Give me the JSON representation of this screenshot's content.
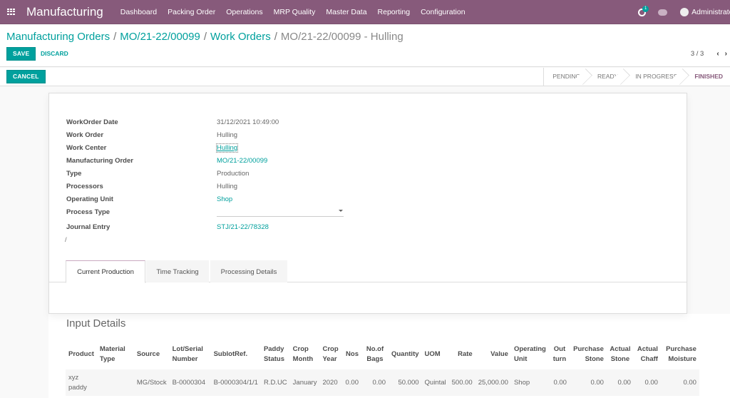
{
  "navbar": {
    "app_name": "Manufacturing",
    "menu": [
      "Dashboard",
      "Packing Order",
      "Operations",
      "MRP Quality",
      "Master Data",
      "Reporting",
      "Configuration"
    ],
    "activity_count": "1",
    "user": "Administrator"
  },
  "breadcrumb": {
    "items": [
      "Manufacturing Orders",
      "MO/21-22/00099",
      "Work Orders"
    ],
    "separator": "/",
    "current": "MO/21-22/00099 - Hulling"
  },
  "buttons": {
    "save": "SAVE",
    "discard": "DISCARD",
    "cancel": "CANCEL"
  },
  "pager": {
    "value": "3 / 3",
    "prev": "‹",
    "next": "›"
  },
  "stages": [
    {
      "label": "PENDING",
      "active": false
    },
    {
      "label": "READY",
      "active": false
    },
    {
      "label": "IN PROGRESS",
      "active": false
    },
    {
      "label": "FINISHED",
      "active": true
    }
  ],
  "form": {
    "fields": [
      {
        "label": "WorkOrder Date",
        "value": "31/12/2021 10:49:00"
      },
      {
        "label": "Work Order",
        "value": "Hulling"
      },
      {
        "label": "Work Center",
        "value": "Hulling"
      },
      {
        "label": "Manufacturing Order",
        "value": "MO/21-22/00099"
      },
      {
        "label": "Type",
        "value": "Production"
      },
      {
        "label": "Processors",
        "value": "Hulling"
      },
      {
        "label": "Operating Unit",
        "value": "Shop"
      },
      {
        "label": "Process Type",
        "value": ""
      },
      {
        "label": "Journal Entry",
        "value": "STJ/21-22/78328"
      }
    ],
    "trailing_text": "/"
  },
  "tabs": [
    "Current Production",
    "Time Tracking",
    "Processing Details"
  ],
  "input_details": {
    "title": "Input Details",
    "columns": [
      "Product",
      "Material Type",
      "Source",
      "Lot/Serial Number",
      "SublotRef.",
      "Paddy Status",
      "Crop Month",
      "Crop Year",
      "Nos",
      "No.of Bags",
      "Quantity",
      "UOM",
      "Rate",
      "Value",
      "Operating Unit",
      "Out turn",
      "Purchase Stone",
      "Actual Stone",
      "Actual Chaff",
      "Purchase Moisture"
    ],
    "rows": [
      [
        "xyz paddy",
        "",
        "MG/Stock",
        "B-0000304",
        "B-0000304/1/1",
        "R.D.UC",
        "January",
        "2020",
        "0.00",
        "0.00",
        "50.000",
        "Quintal",
        "500.00",
        "25,000.00",
        "Shop",
        "0.00",
        "0.00",
        "0.00",
        "0.00",
        "0.00"
      ]
    ]
  }
}
